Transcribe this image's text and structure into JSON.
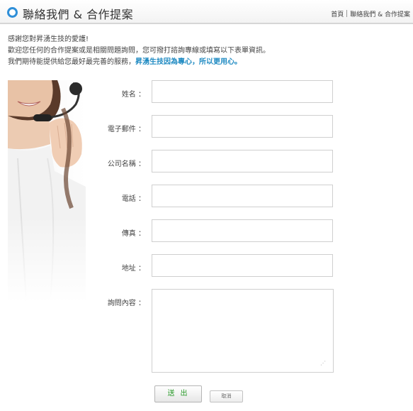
{
  "header": {
    "title": "聯絡我們 & 合作提案",
    "breadcrumb": [
      "首頁",
      "聯絡我們 & 合作提案"
    ]
  },
  "intro": {
    "line1": "感謝您對昇湧生技的愛護!",
    "line2": "歡迎您任何的合作提案或是相關問題詢問，您可撥打諮詢專線或填寫以下表單資訊。",
    "line3_prefix": "我們期待能提供給您最好最完善的服務，",
    "line3_highlight": "昇湧生技因為專心，所以更用心。"
  },
  "form": {
    "fields": [
      {
        "label": "姓名 ：",
        "value": ""
      },
      {
        "label": "電子郵件 ：",
        "value": ""
      },
      {
        "label": "公司名稱 ：",
        "value": ""
      },
      {
        "label": "電話 ：",
        "value": ""
      },
      {
        "label": "傳真 ：",
        "value": ""
      },
      {
        "label": "地址 ：",
        "value": ""
      }
    ],
    "message_label": "詢問內容 ：",
    "message_value": "",
    "submit_label": "送出",
    "cancel_label": "取消"
  },
  "colors": {
    "accent": "#2f8fd8",
    "highlight": "#1f8ac2",
    "submit_text": "#2a9a2a"
  }
}
